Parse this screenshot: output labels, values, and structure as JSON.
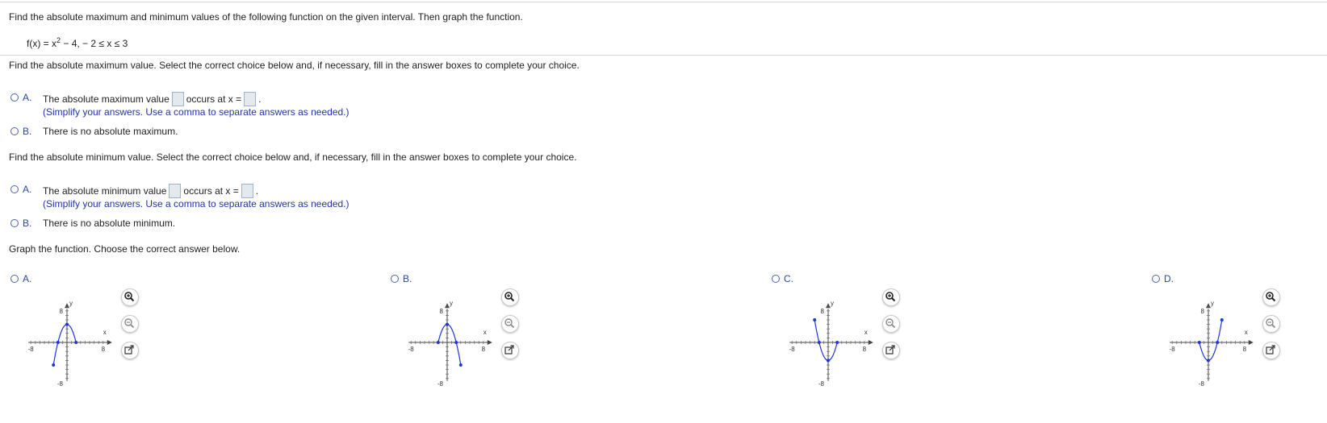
{
  "header": {
    "instruction": "Find the absolute maximum and minimum values of the following function on the given interval. Then graph the function.",
    "function_prefix": "f(x) = x",
    "function_exp": "2",
    "function_suffix": " − 4,  − 2 ≤ x ≤ 3"
  },
  "max_section": {
    "prompt": "Find the absolute maximum value. Select the correct choice below and, if necessary, fill in the answer boxes to complete your choice.",
    "option_a": {
      "letter": "A.",
      "text_before": "The absolute maximum value",
      "text_mid": "occurs at x =",
      "text_end": ".",
      "hint": "(Simplify your answers. Use a comma to separate answers as needed.)"
    },
    "option_b": {
      "letter": "B.",
      "text": "There is no absolute maximum."
    }
  },
  "min_section": {
    "prompt": "Find the absolute minimum value. Select the correct choice below and, if necessary, fill in the answer boxes to complete your choice.",
    "option_a": {
      "letter": "A.",
      "text_before": "The absolute minimum value",
      "text_mid": "occurs at x =",
      "text_end": ".",
      "hint": "(Simplify your answers. Use a comma to separate answers as needed.)"
    },
    "option_b": {
      "letter": "B.",
      "text": "There is no absolute minimum."
    }
  },
  "graph_section": {
    "prompt": "Graph the function. Choose the correct answer below.",
    "options": [
      {
        "letter": "A."
      },
      {
        "letter": "B."
      },
      {
        "letter": "C."
      },
      {
        "letter": "D."
      }
    ]
  },
  "axis_labels": {
    "x": "x",
    "y": "y",
    "xmin": "-8",
    "xmax": "8",
    "ymin": "-8",
    "ymax": "8"
  },
  "chart_data": [
    {
      "type": "line",
      "function": "-(x^2) + 4",
      "x": [
        -3,
        -2,
        -1,
        0,
        1,
        2
      ],
      "y": [
        -5,
        0,
        3,
        4,
        3,
        0
      ],
      "xlim": [
        -8,
        8
      ],
      "ylim": [
        -8,
        8
      ],
      "curve_color": "#1f35d6"
    },
    {
      "type": "line",
      "function": "-(x^2) + 4",
      "x": [
        -2,
        -1,
        0,
        1,
        2,
        3
      ],
      "y": [
        0,
        3,
        4,
        3,
        0,
        -5
      ],
      "xlim": [
        -8,
        8
      ],
      "ylim": [
        -8,
        8
      ],
      "curve_color": "#1f35d6"
    },
    {
      "type": "line",
      "function": "x^2 - 4",
      "x": [
        -3,
        -2,
        -1,
        0,
        1,
        2
      ],
      "y": [
        5,
        0,
        -3,
        -4,
        -3,
        0
      ],
      "xlim": [
        -8,
        8
      ],
      "ylim": [
        -8,
        8
      ],
      "curve_color": "#1f35d6"
    },
    {
      "type": "line",
      "function": "x^2 - 4",
      "x": [
        -2,
        -1,
        0,
        1,
        2,
        3
      ],
      "y": [
        0,
        -3,
        -4,
        -3,
        0,
        5
      ],
      "xlim": [
        -8,
        8
      ],
      "ylim": [
        -8,
        8
      ],
      "curve_color": "#1f35d6"
    }
  ]
}
